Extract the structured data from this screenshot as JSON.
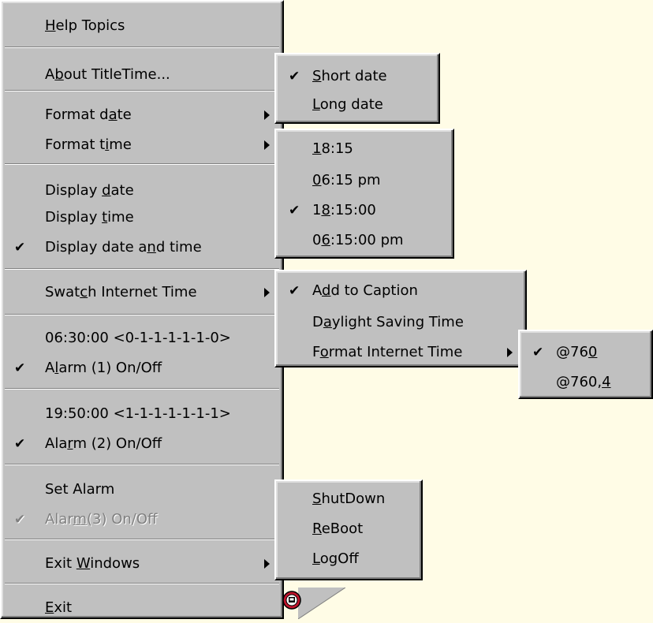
{
  "main_menu": {
    "items": [
      {
        "id": "help-topics",
        "parts": [
          "",
          "H",
          "elp Topics"
        ],
        "checked": false,
        "submenu": false,
        "disabled": false
      },
      {
        "id": "about",
        "parts": [
          "A",
          "b",
          "out TitleTime..."
        ],
        "checked": false,
        "submenu": false,
        "disabled": false
      },
      {
        "id": "format-date",
        "parts": [
          "Format d",
          "a",
          "te"
        ],
        "checked": false,
        "submenu": true,
        "disabled": false
      },
      {
        "id": "format-time",
        "parts": [
          "Format t",
          "i",
          "me"
        ],
        "checked": false,
        "submenu": true,
        "disabled": false
      },
      {
        "id": "display-date",
        "parts": [
          "Display ",
          "d",
          "ate"
        ],
        "checked": false,
        "submenu": false,
        "disabled": false
      },
      {
        "id": "display-time",
        "parts": [
          "Display ",
          "t",
          "ime"
        ],
        "checked": false,
        "submenu": false,
        "disabled": false
      },
      {
        "id": "display-date-and-time",
        "parts": [
          "Display date a",
          "n",
          "d time"
        ],
        "checked": true,
        "submenu": false,
        "disabled": false
      },
      {
        "id": "swatch-internet-time",
        "parts": [
          "Swat",
          "c",
          "h Internet Time"
        ],
        "checked": false,
        "submenu": true,
        "disabled": false
      },
      {
        "id": "alarm1-info",
        "parts": [
          "06:30:00  <0-1-1-1-1-1-0>",
          "",
          ""
        ],
        "checked": false,
        "submenu": false,
        "disabled": false
      },
      {
        "id": "alarm1-toggle",
        "parts": [
          "A",
          "l",
          "arm (1) On/Off"
        ],
        "checked": true,
        "submenu": false,
        "disabled": false
      },
      {
        "id": "alarm2-info",
        "parts": [
          "19:50:00  <1-1-1-1-1-1-1>",
          "",
          ""
        ],
        "checked": false,
        "submenu": false,
        "disabled": false
      },
      {
        "id": "alarm2-toggle",
        "parts": [
          "Ala",
          "r",
          "m (2) On/Off"
        ],
        "checked": true,
        "submenu": false,
        "disabled": false
      },
      {
        "id": "set-alarm",
        "parts": [
          "Set Alarm",
          "",
          ""
        ],
        "checked": false,
        "submenu": false,
        "disabled": false
      },
      {
        "id": "alarm3-toggle",
        "parts": [
          "Alar",
          "m",
          "(3) On/Off"
        ],
        "checked": true,
        "submenu": false,
        "disabled": true
      },
      {
        "id": "exit-windows",
        "parts": [
          "Exit ",
          "W",
          "indows"
        ],
        "checked": false,
        "submenu": true,
        "disabled": false
      },
      {
        "id": "exit",
        "parts": [
          "",
          "E",
          "xit"
        ],
        "checked": false,
        "submenu": false,
        "disabled": false
      }
    ]
  },
  "date_format_menu": {
    "items": [
      {
        "id": "short-date",
        "parts": [
          "",
          "S",
          "hort date"
        ],
        "checked": true,
        "submenu": false,
        "disabled": false
      },
      {
        "id": "long-date",
        "parts": [
          "",
          "L",
          "ong date"
        ],
        "checked": false,
        "submenu": false,
        "disabled": false
      }
    ]
  },
  "time_format_menu": {
    "items": [
      {
        "id": "time-1815",
        "parts": [
          "",
          "1",
          "8:15"
        ],
        "checked": false,
        "submenu": false,
        "disabled": false
      },
      {
        "id": "time-0615pm",
        "parts": [
          "",
          "0",
          "6:15 pm"
        ],
        "checked": false,
        "submenu": false,
        "disabled": false
      },
      {
        "id": "time-181500",
        "parts": [
          "1",
          "8",
          ":15:00"
        ],
        "checked": true,
        "submenu": false,
        "disabled": false
      },
      {
        "id": "time-061500pm",
        "parts": [
          "0",
          "6",
          ":15:00 pm"
        ],
        "checked": false,
        "submenu": false,
        "disabled": false
      }
    ]
  },
  "swatch_menu": {
    "items": [
      {
        "id": "add-to-caption",
        "parts": [
          "A",
          "d",
          "d to Caption"
        ],
        "checked": true,
        "submenu": false,
        "disabled": false
      },
      {
        "id": "daylight-saving",
        "parts": [
          "D",
          "a",
          "ylight Saving Time"
        ],
        "checked": false,
        "submenu": false,
        "disabled": false
      },
      {
        "id": "format-internet-time",
        "parts": [
          "F",
          "o",
          "rmat Internet Time"
        ],
        "checked": false,
        "submenu": true,
        "disabled": false
      }
    ]
  },
  "internet_time_format_menu": {
    "items": [
      {
        "id": "beat-760",
        "parts": [
          "@76",
          "0",
          ""
        ],
        "checked": true,
        "submenu": false,
        "disabled": false
      },
      {
        "id": "beat-7604",
        "parts": [
          "@760,",
          "4",
          ""
        ],
        "checked": false,
        "submenu": false,
        "disabled": false
      }
    ]
  },
  "exit_windows_menu": {
    "items": [
      {
        "id": "shutdown",
        "parts": [
          "",
          "S",
          "hutDown"
        ],
        "checked": false,
        "submenu": false,
        "disabled": false
      },
      {
        "id": "reboot",
        "parts": [
          "",
          "R",
          "eBoot"
        ],
        "checked": false,
        "submenu": false,
        "disabled": false
      },
      {
        "id": "logoff",
        "parts": [
          "",
          "L",
          "ogOff"
        ],
        "checked": false,
        "submenu": false,
        "disabled": false
      }
    ]
  },
  "check_glyph": "✔",
  "tray_icon": "alarm-clock-icon",
  "colors": {
    "menu_bg": "#C0C0C0",
    "desktop_bg": "#FFFCE6",
    "disabled_text": "#808080",
    "icon_red": "#C0142C"
  }
}
